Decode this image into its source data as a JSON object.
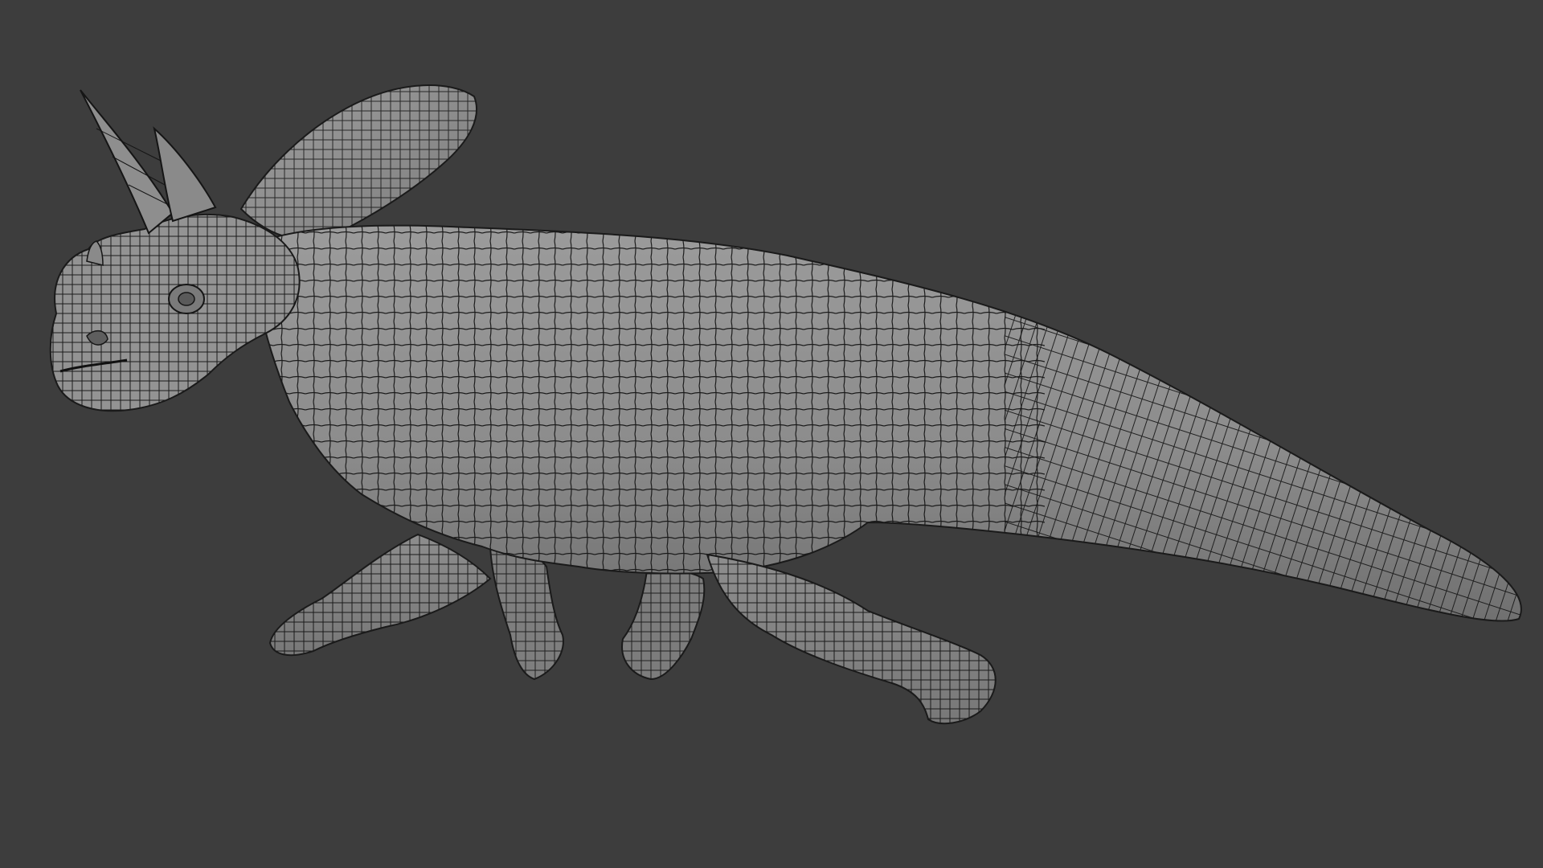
{
  "viewport": {
    "background_color": "#3d3d3d"
  },
  "model": {
    "kind": "wireframe-mesh-render",
    "subject": "horned-dinosaur",
    "shading_colors": {
      "light": "#9a9a9a",
      "mid": "#858585",
      "dark": "#6c6c6c",
      "wire": "#141414"
    }
  }
}
